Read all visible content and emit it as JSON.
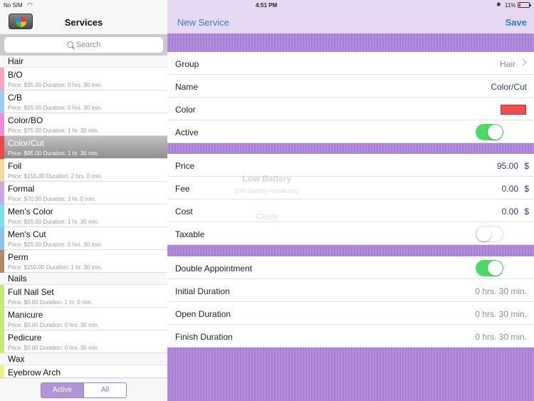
{
  "status_bar": {
    "carrier": "No SIM",
    "time": "4:51 PM",
    "battery": "11%"
  },
  "left": {
    "title": "Services",
    "search_placeholder": "Search",
    "sections": [
      {
        "header": "Hair",
        "items": [
          {
            "name": "B/O",
            "detail": "Price: $35.00   Duration: 0 hrs. 30 min.",
            "color": "#f4a6c0"
          },
          {
            "name": "C/B",
            "detail": "Price: $55.00   Duration: 0 hrs. 30 min.",
            "color": "#9ecbee"
          },
          {
            "name": "Color/BO",
            "detail": "Price: $75.00   Duration: 1 hr. 30 min.",
            "color": "#ee8fd6"
          },
          {
            "name": "Color/Cut",
            "detail": "Price: $95.00   Duration: 1 hr. 30 min.",
            "color": "#e84a4a",
            "selected": true
          },
          {
            "name": "Foil",
            "detail": "Price: $155.00   Duration: 2 hrs. 0 min.",
            "color": "#f5d9a0"
          },
          {
            "name": "Formal",
            "detail": "Price: $70.00   Duration: 1 hr. 0 min.",
            "color": "#c9a8e6"
          },
          {
            "name": "Men's Color",
            "detail": "Price: $55.00   Duration: 1 hr. 30 min.",
            "color": "#7de0e6"
          },
          {
            "name": "Men's Cut",
            "detail": "Price: $29.00   Duration: 0 hrs. 30 min.",
            "color": "#8fc3ee"
          },
          {
            "name": "Perm",
            "detail": "Price: $150.00   Duration: 1 hr. 30 min.",
            "color": "#b08a6a"
          }
        ]
      },
      {
        "header": "Nails",
        "items": [
          {
            "name": "Full Nail Set",
            "detail": "Price: $0.00   Duration: 1 hr. 0 min.",
            "color": "#c8e87a"
          },
          {
            "name": "Manicure",
            "detail": "Price: $0.00   Duration: 0 hrs. 30 min.",
            "color": "#c8e87a"
          },
          {
            "name": "Pedicure",
            "detail": "Price: $0.00   Duration: 0 hrs. 30 min.",
            "color": "#c8e87a"
          }
        ]
      },
      {
        "header": "Wax",
        "items": [
          {
            "name": "Eyebrow Arch",
            "detail": "",
            "color": "#f0ee8a"
          }
        ]
      }
    ],
    "segment": {
      "active": "Active",
      "all": "All"
    }
  },
  "right": {
    "new_service": "New Service",
    "save": "Save",
    "group_label": "Group",
    "group_value": "Hair",
    "name_label": "Name",
    "name_value": "Color/Cut",
    "color_label": "Color",
    "color_value": "#f14d4d",
    "active_label": "Active",
    "active_on": true,
    "price_label": "Price",
    "price_value": "95.00",
    "fee_label": "Fee",
    "fee_value": "0.00",
    "cost_label": "Cost",
    "cost_value": "0.00",
    "currency": "$",
    "taxable_label": "Taxable",
    "taxable_on": false,
    "double_label": "Double Appointment",
    "double_on": true,
    "initial_label": "Initial Duration",
    "initial_value": "0 hrs. 30 min.",
    "open_label": "Open Duration",
    "open_value": "0 hrs. 30 min.",
    "finish_label": "Finish Duration",
    "finish_value": "0 hrs. 30 min."
  },
  "overlay": {
    "title": "Low Battery",
    "message": "10% battery remaining.",
    "close": "Close"
  },
  "accent": "#b28edc"
}
